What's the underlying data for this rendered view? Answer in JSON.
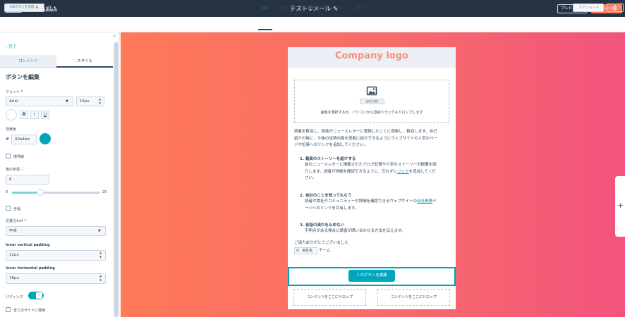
{
  "topbar": {
    "exit_label": "終了",
    "autosave_label": "自動保存しました",
    "title": "テスト①メール",
    "preview_label": "プレビュー",
    "send_label": "確認および送信"
  },
  "subbar": {
    "ab_test_label": "A/Bテストを作成",
    "tabs": [
      {
        "label": "編集",
        "active": true
      },
      {
        "label": "設定",
        "active": false
      },
      {
        "label": "送信またはスケジュール",
        "active": false
      },
      {
        "label": "自動化",
        "active": false
      }
    ],
    "actions_label": "アクション"
  },
  "panel": {
    "back_label": "完了",
    "tabs": [
      {
        "label": "コンテンツ",
        "active": false
      },
      {
        "label": "スタイル",
        "active": true
      }
    ],
    "section_title": "ボタンを編集",
    "font_label": "フォント *",
    "font_value": "Arial",
    "font_size_value": "16px",
    "bold_label": "B",
    "italic_label": "I",
    "underline_label": "U",
    "bg_color_label": "背景色",
    "bg_color_value": "00a4bd",
    "bg_color_hex": "#00a4bd",
    "border_label": "境界線",
    "radius_label": "角の半径",
    "radius_value": "8",
    "slider_min": "0",
    "slider_max": "25",
    "slider_fraction": 0.32,
    "fullwidth_label": "全幅",
    "alignment_label": "位置合わせ *",
    "alignment_value": "中央",
    "vpad_label": "Inner vertical padding",
    "vpad_value": "12px",
    "hpad_label": "Inner horizontal padding",
    "hpad_value": "18px",
    "padding_label": "パディング",
    "apply_all_label": "全てのサイドに適用"
  },
  "email": {
    "logo_text": "Company logo",
    "image_button": "画像を選択",
    "image_hint": "画像を選択するか、パソコンから直接ドラッグ＆ドロップします",
    "intro_line1": "読者を歓迎し、読者がニュースレターに登録したことに感謝し、歓迎します。自己",
    "intro_line2": "紹介の後に、今後の試読内容を読者に紹介できるようにウェブサイトの人気のペー",
    "intro_line3": "ジや記事へのリンクを追加してください。",
    "item1_title": "1. 最高のストーリーを紹介する",
    "item1_line1": "前のニュースレターに掲載されたブログ記事や人気のストーリーの概要を紹",
    "item1_line2_pre": "介します。読者が詳細を確認できるように、忘れずに",
    "item1_link": "リンク",
    "item1_line2_post": "を追加してくだ",
    "item1_line3": "さい。",
    "item2_title": "2. 自社のことを知ってもらう",
    "item2_line1_pre": "読者が貴社やコミュニティーの詳細を確認できるウェブサイトの",
    "item2_link": "会社概要",
    "item2_line1_post": "ペ",
    "item2_line2": "ージへのリンクを共有します。",
    "item3_title": "3. 会話の流れを止めない",
    "item3_line1": "不明点がある場合に読者が問い合わせる方法を伝えます。",
    "thanks": "ご協力ありがとうございました",
    "company_token": "会社名",
    "team_suffix": "チーム",
    "cta_label": "このボタンを編集",
    "dropzone_left": "コンテンツをここにドロップ",
    "dropzone_right": "コンテンツをここにドロップ"
  }
}
